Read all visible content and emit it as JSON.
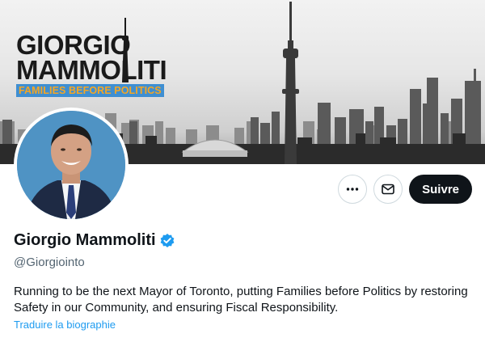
{
  "banner": {
    "logo_line1": "GIORGIO",
    "logo_line2": "MAMMOLITI",
    "tagline": "FAMILIES BEFORE POLITICS"
  },
  "profile": {
    "display_name": "Giorgio Mammoliti",
    "verified_icon": "verified-badge-icon",
    "handle": "@Giorgiointo",
    "bio": "Running to be the next Mayor of Toronto, putting Families before Politics by restoring Safety in our Community, and ensuring Fiscal Responsibility.",
    "translate_link": "Traduire la biographie"
  },
  "actions": {
    "more_icon": "more-icon",
    "message_icon": "message-icon",
    "follow_label": "Suivre"
  },
  "colors": {
    "accent": "#1d9bf0",
    "follow_bg": "#0f1419",
    "muted_text": "#536471",
    "tagline_bg": "#3f8fd2",
    "tagline_text": "#f5a623"
  }
}
